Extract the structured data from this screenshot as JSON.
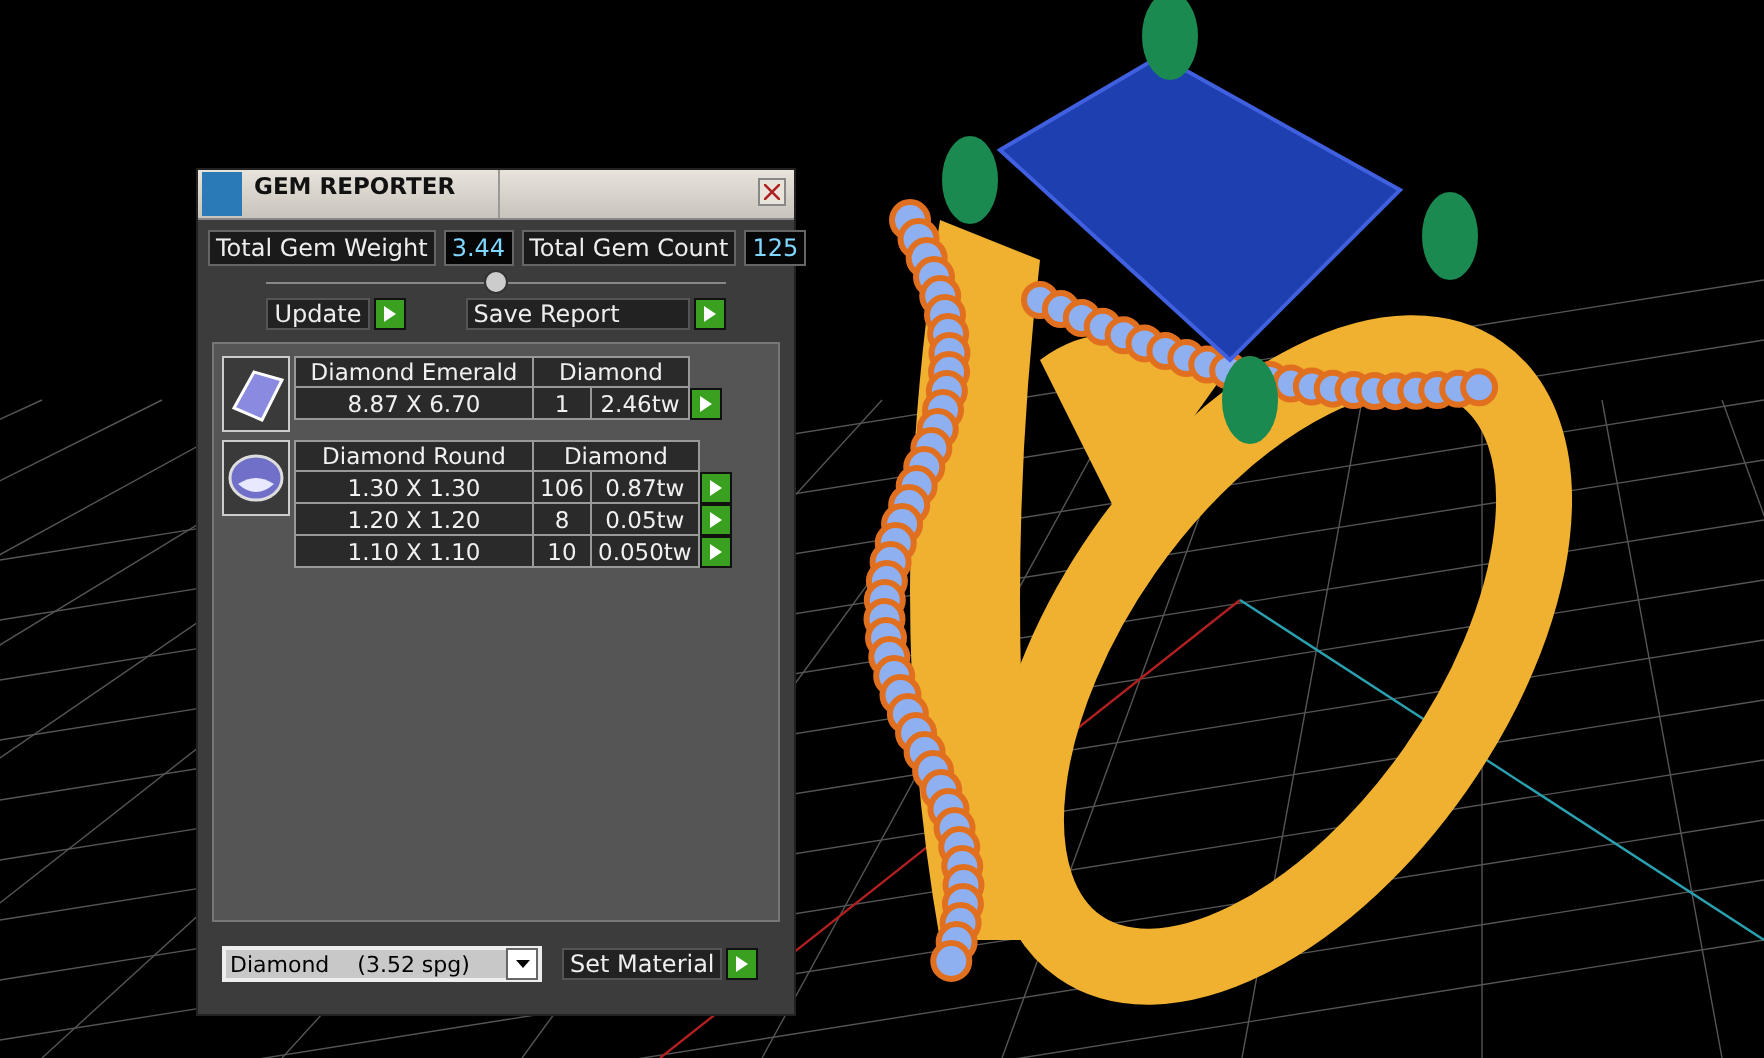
{
  "window": {
    "title": "GEM REPORTER"
  },
  "totals": [
    {
      "label": "Total Gem Weight",
      "value": "3.44"
    },
    {
      "label": "Total Gem Count",
      "value": "125"
    }
  ],
  "actions": [
    {
      "label": "Update"
    },
    {
      "label": "Save Report"
    }
  ],
  "gem_groups": [
    {
      "kind": "emerald",
      "name": "Diamond Emerald",
      "material": "Diamond",
      "rows": [
        {
          "size": "8.87 X 6.70",
          "count": "1",
          "weight": "2.46tw"
        }
      ]
    },
    {
      "kind": "round",
      "name": "Diamond Round",
      "material": "Diamond",
      "rows": [
        {
          "size": "1.30 X 1.30",
          "count": "106",
          "weight": "0.87tw"
        },
        {
          "size": "1.20 X 1.20",
          "count": "8",
          "weight": "0.05tw"
        },
        {
          "size": "1.10 X 1.10",
          "count": "10",
          "weight": "0.050tw"
        }
      ]
    }
  ],
  "material_select": {
    "value": "Diamond    (3.52 spg)"
  },
  "set_material": {
    "label": "Set Material"
  }
}
